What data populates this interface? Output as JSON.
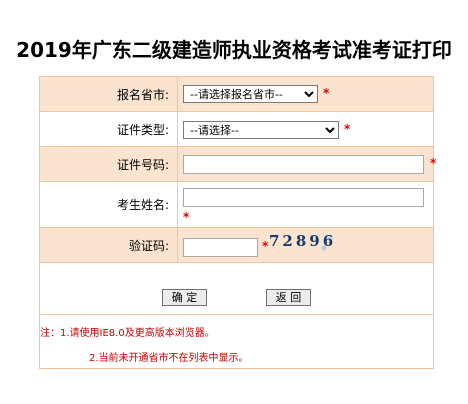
{
  "page": {
    "title": "2019年广东二级建造师执业资格考试准考证打印"
  },
  "form": {
    "province": {
      "label": "报名省市:",
      "selected": "--请选择报名省市--",
      "required_mark": "*"
    },
    "id_type": {
      "label": "证件类型:",
      "selected": "--请选择--",
      "required_mark": "*"
    },
    "id_number": {
      "label": "证件号码:",
      "value": "",
      "required_mark": "*"
    },
    "name": {
      "label": "考生姓名:",
      "value": "",
      "required_mark": "*"
    },
    "captcha": {
      "label": "验证码:",
      "value": "",
      "required_mark": "*",
      "image_text": "72896"
    },
    "buttons": {
      "confirm": "确 定",
      "back": "返 回"
    }
  },
  "notes": {
    "line1": "注：1.请使用IE8.0及更高版本浏览器。",
    "line2": "2.当前未开通省市不在列表中显示。"
  },
  "colors": {
    "border": "#f2c49b",
    "alt_row": "#fbe4cf",
    "required": "#e60000",
    "note": "#cc0000"
  }
}
